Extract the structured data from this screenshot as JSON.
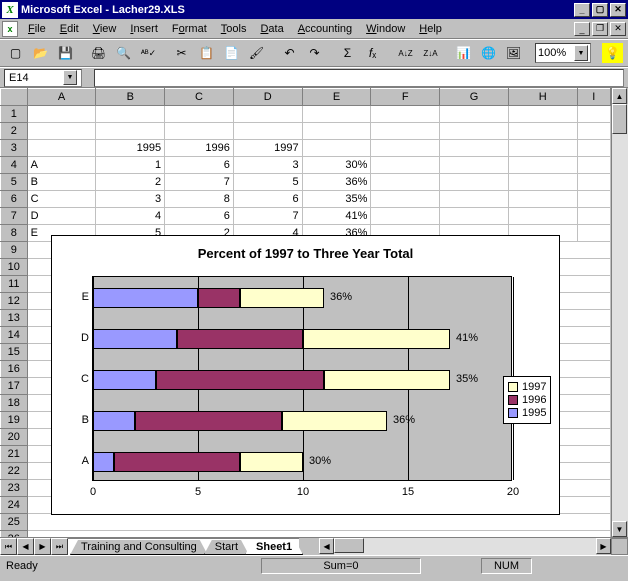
{
  "app": {
    "title": "Microsoft Excel - Lacher29.XLS"
  },
  "menu": {
    "file": "File",
    "edit": "Edit",
    "view": "View",
    "insert": "Insert",
    "format": "Format",
    "tools": "Tools",
    "data": "Data",
    "accounting": "Accounting",
    "window": "Window",
    "help": "Help"
  },
  "toolbar": {
    "zoom": "100%"
  },
  "namebox": "E14",
  "columns": [
    "A",
    "B",
    "C",
    "D",
    "E",
    "F",
    "G",
    "H",
    "I"
  ],
  "data": {
    "years": {
      "y1": "1995",
      "y2": "1996",
      "y3": "1997"
    },
    "rows": [
      {
        "lbl": "A",
        "v1": "1",
        "v2": "6",
        "v3": "3",
        "pct": "30%"
      },
      {
        "lbl": "B",
        "v1": "2",
        "v2": "7",
        "v3": "5",
        "pct": "36%"
      },
      {
        "lbl": "C",
        "v1": "3",
        "v2": "8",
        "v3": "6",
        "pct": "35%"
      },
      {
        "lbl": "D",
        "v1": "4",
        "v2": "6",
        "v3": "7",
        "pct": "41%"
      },
      {
        "lbl": "E",
        "v1": "5",
        "v2": "2",
        "v3": "4",
        "pct": "36%"
      }
    ]
  },
  "chart_data": {
    "type": "bar",
    "title": "Percent of 1997 to Three Year Total",
    "orientation": "horizontal-stacked",
    "categories": [
      "A",
      "B",
      "C",
      "D",
      "E"
    ],
    "series": [
      {
        "name": "1995",
        "color": "#9999ff",
        "values": [
          1,
          2,
          3,
          4,
          5
        ]
      },
      {
        "name": "1996",
        "color": "#993366",
        "values": [
          6,
          7,
          8,
          6,
          2
        ]
      },
      {
        "name": "1997",
        "color": "#ffffcc",
        "values": [
          3,
          5,
          6,
          7,
          4
        ]
      }
    ],
    "data_labels": [
      "30%",
      "36%",
      "35%",
      "41%",
      "36%"
    ],
    "xlim": [
      0,
      20
    ],
    "xticks": [
      0,
      5,
      10,
      15,
      20
    ],
    "legend": [
      "1997",
      "1996",
      "1995"
    ]
  },
  "tabs": {
    "t1": "Training and Consulting",
    "t2": "Start",
    "t3": "Sheet1"
  },
  "status": {
    "ready": "Ready",
    "sum": "Sum=0",
    "num": "NUM"
  }
}
